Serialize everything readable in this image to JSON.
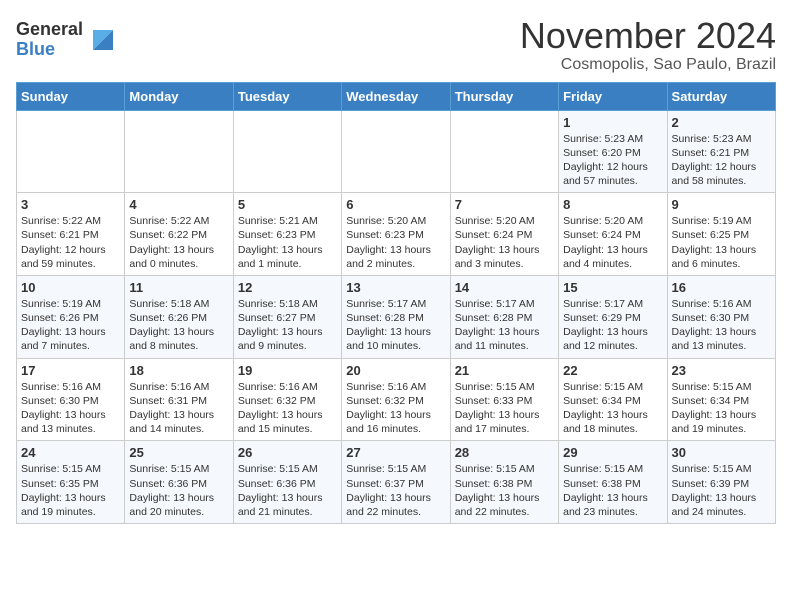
{
  "header": {
    "logo_line1": "General",
    "logo_line2": "Blue",
    "title": "November 2024",
    "subtitle": "Cosmopolis, Sao Paulo, Brazil"
  },
  "days_of_week": [
    "Sunday",
    "Monday",
    "Tuesday",
    "Wednesday",
    "Thursday",
    "Friday",
    "Saturday"
  ],
  "weeks": [
    [
      {
        "day": "",
        "text": ""
      },
      {
        "day": "",
        "text": ""
      },
      {
        "day": "",
        "text": ""
      },
      {
        "day": "",
        "text": ""
      },
      {
        "day": "",
        "text": ""
      },
      {
        "day": "1",
        "text": "Sunrise: 5:23 AM\nSunset: 6:20 PM\nDaylight: 12 hours and 57 minutes."
      },
      {
        "day": "2",
        "text": "Sunrise: 5:23 AM\nSunset: 6:21 PM\nDaylight: 12 hours and 58 minutes."
      }
    ],
    [
      {
        "day": "3",
        "text": "Sunrise: 5:22 AM\nSunset: 6:21 PM\nDaylight: 12 hours and 59 minutes."
      },
      {
        "day": "4",
        "text": "Sunrise: 5:22 AM\nSunset: 6:22 PM\nDaylight: 13 hours and 0 minutes."
      },
      {
        "day": "5",
        "text": "Sunrise: 5:21 AM\nSunset: 6:23 PM\nDaylight: 13 hours and 1 minute."
      },
      {
        "day": "6",
        "text": "Sunrise: 5:20 AM\nSunset: 6:23 PM\nDaylight: 13 hours and 2 minutes."
      },
      {
        "day": "7",
        "text": "Sunrise: 5:20 AM\nSunset: 6:24 PM\nDaylight: 13 hours and 3 minutes."
      },
      {
        "day": "8",
        "text": "Sunrise: 5:20 AM\nSunset: 6:24 PM\nDaylight: 13 hours and 4 minutes."
      },
      {
        "day": "9",
        "text": "Sunrise: 5:19 AM\nSunset: 6:25 PM\nDaylight: 13 hours and 6 minutes."
      }
    ],
    [
      {
        "day": "10",
        "text": "Sunrise: 5:19 AM\nSunset: 6:26 PM\nDaylight: 13 hours and 7 minutes."
      },
      {
        "day": "11",
        "text": "Sunrise: 5:18 AM\nSunset: 6:26 PM\nDaylight: 13 hours and 8 minutes."
      },
      {
        "day": "12",
        "text": "Sunrise: 5:18 AM\nSunset: 6:27 PM\nDaylight: 13 hours and 9 minutes."
      },
      {
        "day": "13",
        "text": "Sunrise: 5:17 AM\nSunset: 6:28 PM\nDaylight: 13 hours and 10 minutes."
      },
      {
        "day": "14",
        "text": "Sunrise: 5:17 AM\nSunset: 6:28 PM\nDaylight: 13 hours and 11 minutes."
      },
      {
        "day": "15",
        "text": "Sunrise: 5:17 AM\nSunset: 6:29 PM\nDaylight: 13 hours and 12 minutes."
      },
      {
        "day": "16",
        "text": "Sunrise: 5:16 AM\nSunset: 6:30 PM\nDaylight: 13 hours and 13 minutes."
      }
    ],
    [
      {
        "day": "17",
        "text": "Sunrise: 5:16 AM\nSunset: 6:30 PM\nDaylight: 13 hours and 13 minutes."
      },
      {
        "day": "18",
        "text": "Sunrise: 5:16 AM\nSunset: 6:31 PM\nDaylight: 13 hours and 14 minutes."
      },
      {
        "day": "19",
        "text": "Sunrise: 5:16 AM\nSunset: 6:32 PM\nDaylight: 13 hours and 15 minutes."
      },
      {
        "day": "20",
        "text": "Sunrise: 5:16 AM\nSunset: 6:32 PM\nDaylight: 13 hours and 16 minutes."
      },
      {
        "day": "21",
        "text": "Sunrise: 5:15 AM\nSunset: 6:33 PM\nDaylight: 13 hours and 17 minutes."
      },
      {
        "day": "22",
        "text": "Sunrise: 5:15 AM\nSunset: 6:34 PM\nDaylight: 13 hours and 18 minutes."
      },
      {
        "day": "23",
        "text": "Sunrise: 5:15 AM\nSunset: 6:34 PM\nDaylight: 13 hours and 19 minutes."
      }
    ],
    [
      {
        "day": "24",
        "text": "Sunrise: 5:15 AM\nSunset: 6:35 PM\nDaylight: 13 hours and 19 minutes."
      },
      {
        "day": "25",
        "text": "Sunrise: 5:15 AM\nSunset: 6:36 PM\nDaylight: 13 hours and 20 minutes."
      },
      {
        "day": "26",
        "text": "Sunrise: 5:15 AM\nSunset: 6:36 PM\nDaylight: 13 hours and 21 minutes."
      },
      {
        "day": "27",
        "text": "Sunrise: 5:15 AM\nSunset: 6:37 PM\nDaylight: 13 hours and 22 minutes."
      },
      {
        "day": "28",
        "text": "Sunrise: 5:15 AM\nSunset: 6:38 PM\nDaylight: 13 hours and 22 minutes."
      },
      {
        "day": "29",
        "text": "Sunrise: 5:15 AM\nSunset: 6:38 PM\nDaylight: 13 hours and 23 minutes."
      },
      {
        "day": "30",
        "text": "Sunrise: 5:15 AM\nSunset: 6:39 PM\nDaylight: 13 hours and 24 minutes."
      }
    ]
  ]
}
